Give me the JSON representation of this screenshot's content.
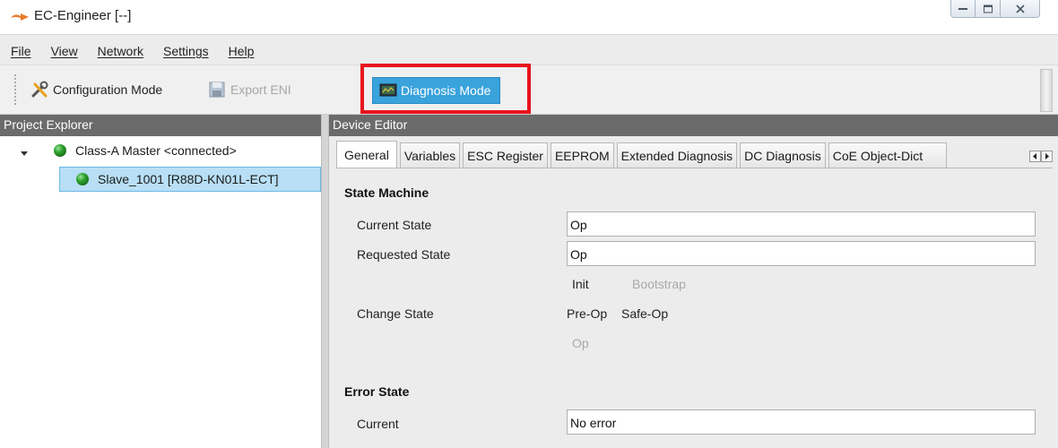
{
  "window": {
    "title": "EC-Engineer [--]",
    "controls": [
      "minimize",
      "maximize",
      "close"
    ]
  },
  "menu": [
    "File",
    "View",
    "Network",
    "Settings",
    "Help"
  ],
  "toolbar": {
    "configuration_mode": "Configuration Mode",
    "export_eni": "Export ENI",
    "diagnosis_mode": "Diagnosis Mode",
    "highlight_color": "#e8141b",
    "active_color": "#3aa3dc"
  },
  "project_explorer": {
    "title": "Project Explorer",
    "master": "Class-A Master <connected>",
    "slave": "Slave_1001 [R88D-KN01L-ECT]"
  },
  "device_editor": {
    "title": "Device Editor",
    "tabs": [
      "General",
      "Variables",
      "ESC Register",
      "EEPROM",
      "Extended Diagnosis",
      "DC Diagnosis",
      "CoE Object-Dict"
    ],
    "active_tab": "General"
  },
  "general": {
    "state_machine": {
      "title": "State Machine",
      "current_state_label": "Current State",
      "current_state_value": "Op",
      "requested_state_label": "Requested State",
      "requested_state_value": "Op",
      "change_state_label": "Change State",
      "buttons": {
        "init": "Init",
        "bootstrap": "Bootstrap",
        "preop": "Pre-Op",
        "safeop": "Safe-Op",
        "op": "Op"
      }
    },
    "error_state": {
      "title": "Error State",
      "current_label": "Current",
      "current_value": "No error"
    }
  }
}
